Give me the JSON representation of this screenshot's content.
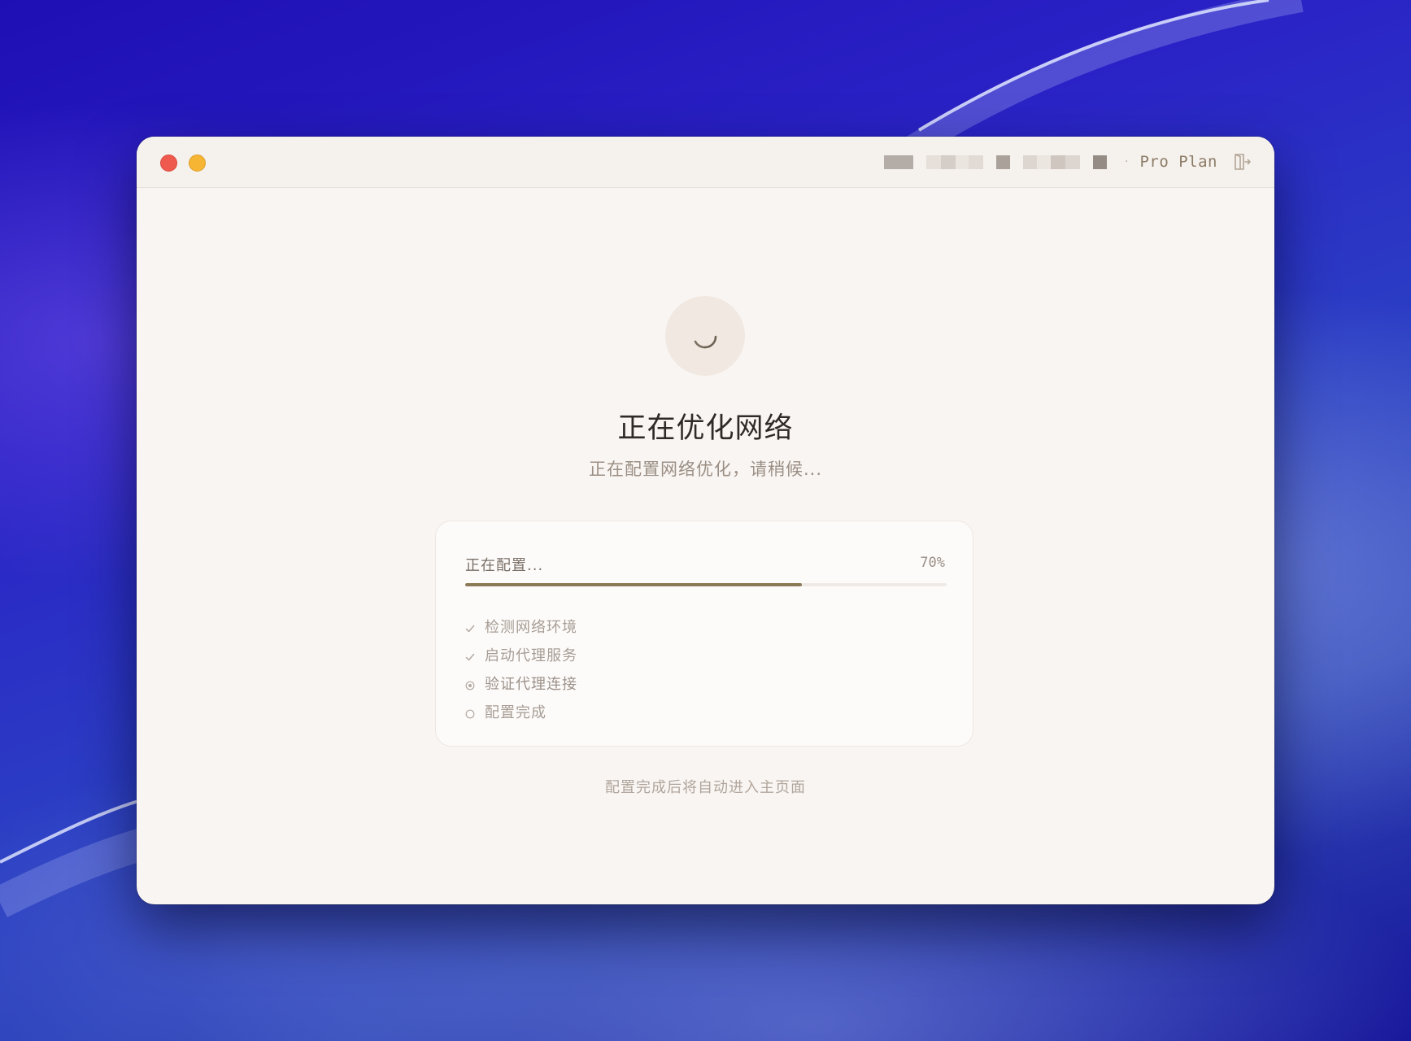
{
  "titlebar": {
    "plan_separator": "·",
    "plan_label": "Pro Plan",
    "icons": {
      "close": "close-dot",
      "minimize": "minimize-dot",
      "logout": "logout-icon"
    }
  },
  "status": {
    "title": "正在优化网络",
    "subtitle": "正在配置网络优化，请稍候..."
  },
  "progress": {
    "label": "正在配置...",
    "percent_text": "70%",
    "value": 0.7,
    "accent_color": "#8a7a55"
  },
  "steps": [
    {
      "label": "检测网络环境",
      "state": "done",
      "icon": "check-icon"
    },
    {
      "label": "启动代理服务",
      "state": "done",
      "icon": "check-icon"
    },
    {
      "label": "验证代理连接",
      "state": "in-progress",
      "icon": "target-icon"
    },
    {
      "label": "配置完成",
      "state": "pending",
      "icon": "circle-icon"
    }
  ],
  "footer": {
    "note": "配置完成后将自动进入主页面"
  },
  "colors": {
    "window_background": "#f9f5f2",
    "close_button": "#ef5a4e",
    "minimize_button": "#f6b533"
  }
}
